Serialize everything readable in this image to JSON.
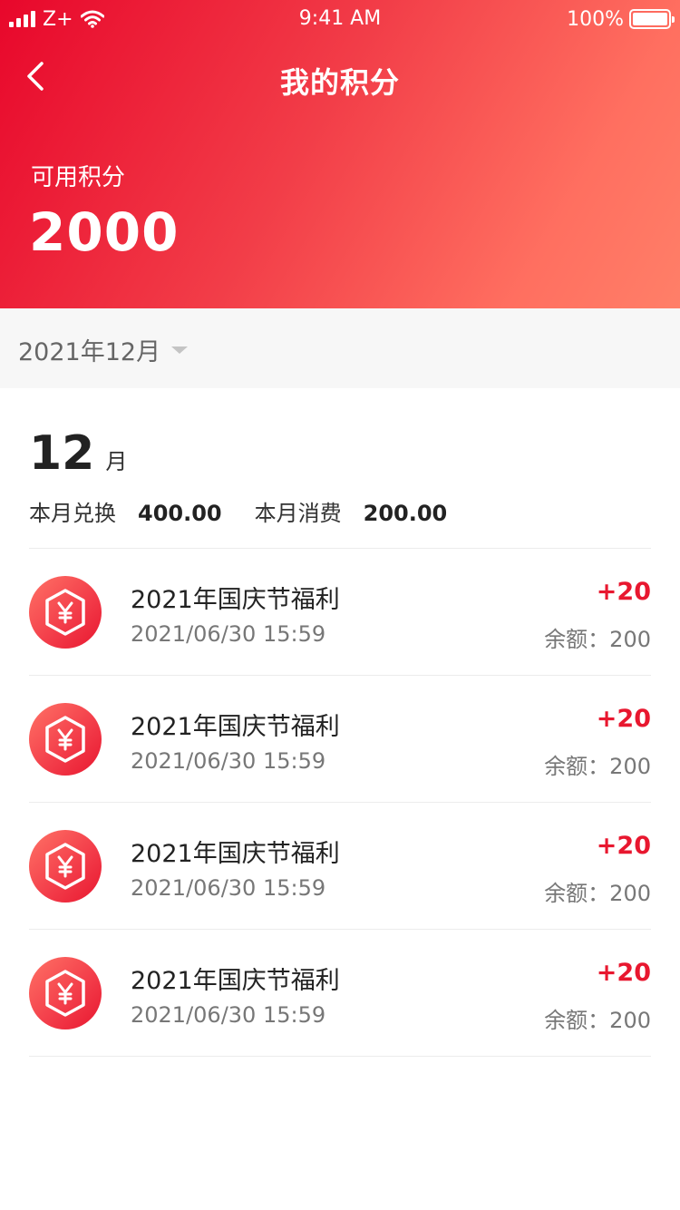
{
  "status_bar": {
    "carrier": "Z+",
    "time": "9:41 AM",
    "battery": "100%"
  },
  "nav": {
    "title": "我的积分",
    "back_icon": "chevron-left-icon"
  },
  "points": {
    "label": "可用积分",
    "value": "2000"
  },
  "filter": {
    "month": "2021年12月"
  },
  "summary": {
    "month_num": "12",
    "month_unit": "月",
    "exchange_label": "本月兑换",
    "exchange_value": "400.00",
    "consume_label": "本月消费",
    "consume_value": "200.00"
  },
  "records": [
    {
      "title": "2021年国庆节福利",
      "time": "2021/06/30 15:59",
      "amount": "+20",
      "balance": "余额：200",
      "icon": "yuan-coin-icon"
    },
    {
      "title": "2021年国庆节福利",
      "time": "2021/06/30 15:59",
      "amount": "+20",
      "balance": "余额：200",
      "icon": "yuan-coin-icon"
    },
    {
      "title": "2021年国庆节福利",
      "time": "2021/06/30 15:59",
      "amount": "+20",
      "balance": "余额：200",
      "icon": "yuan-coin-icon"
    },
    {
      "title": "2021年国庆节福利",
      "time": "2021/06/30 15:59",
      "amount": "+20",
      "balance": "余额：200",
      "icon": "yuan-coin-icon"
    }
  ],
  "colors": {
    "accent": "#e8172f",
    "header_start": "#e8072b",
    "header_end": "#ff7f68"
  }
}
